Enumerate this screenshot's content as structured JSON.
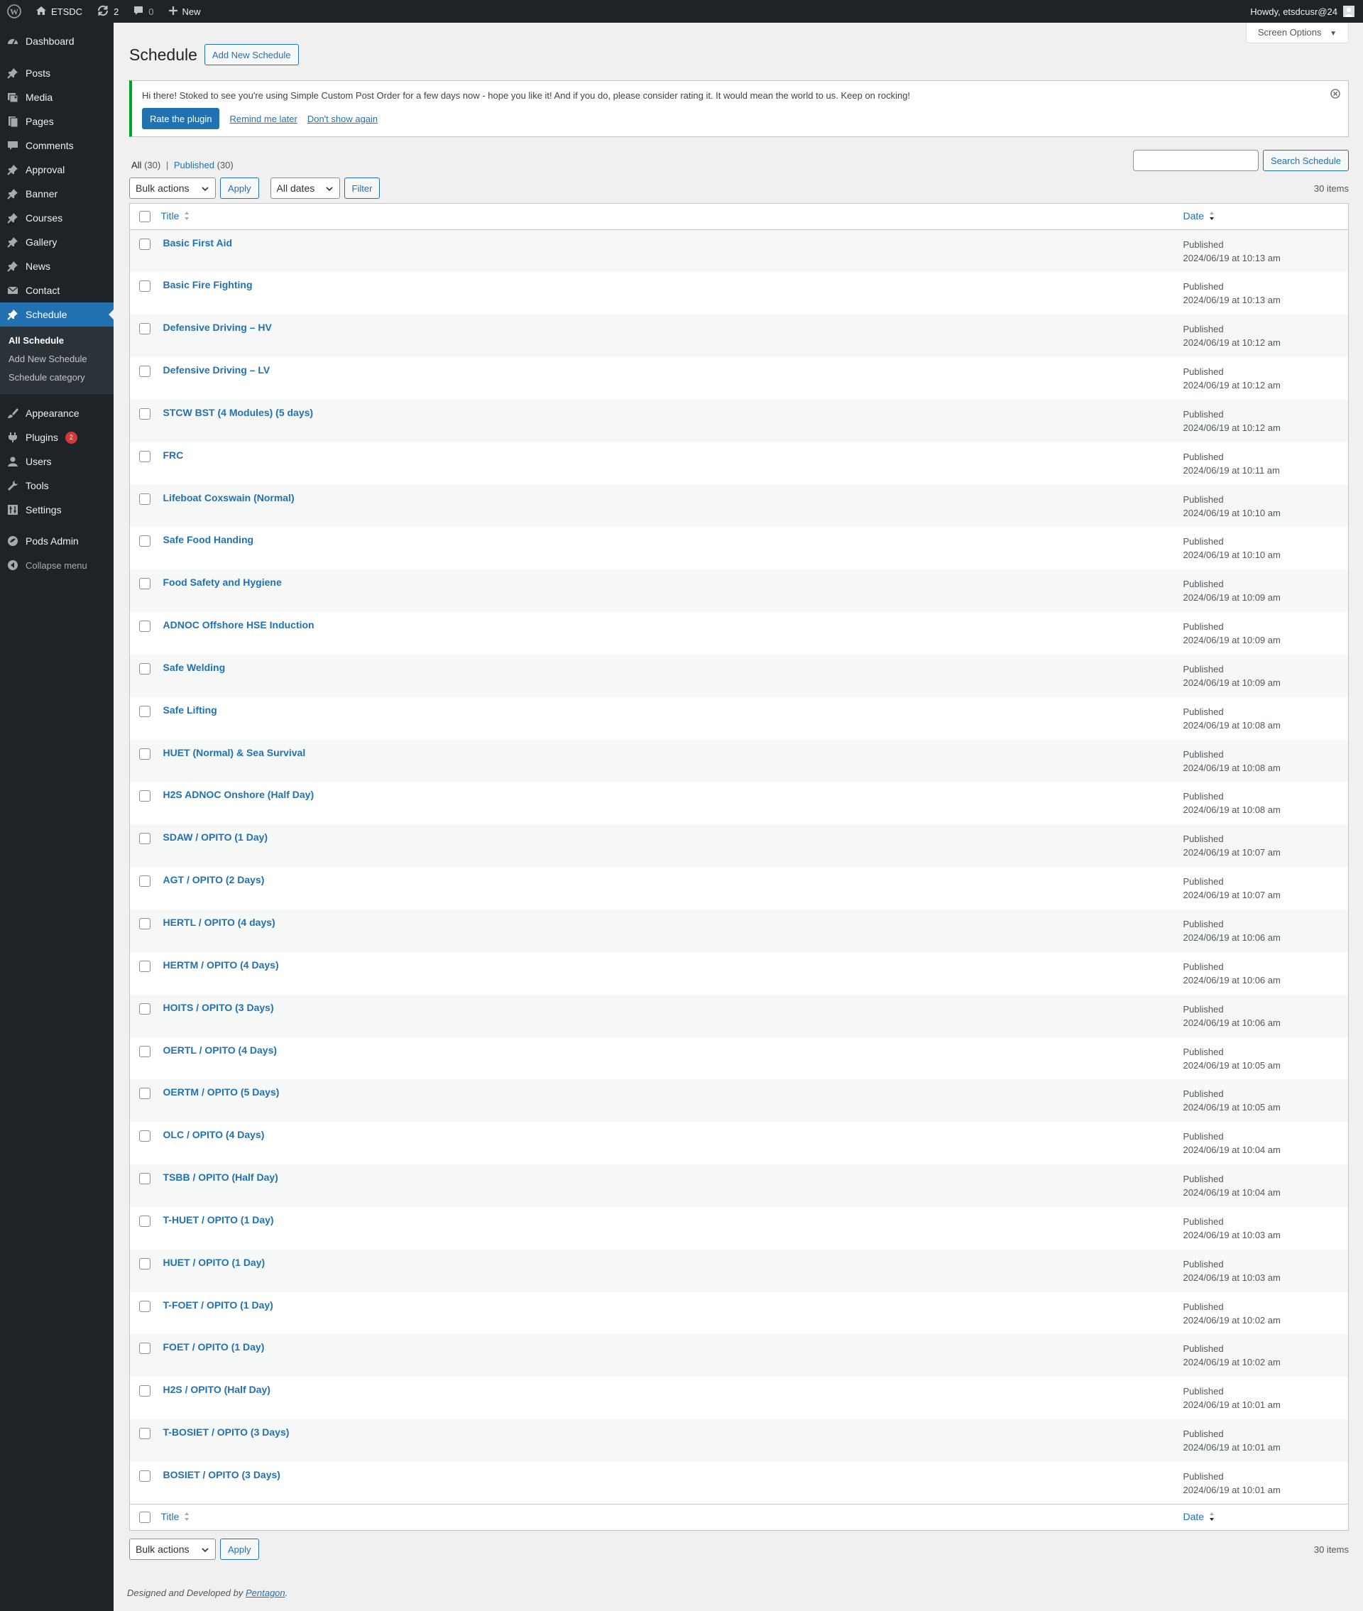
{
  "adminbar": {
    "site_name": "ETSDC",
    "updates_count": "2",
    "comments_count": "0",
    "new_label": "New",
    "howdy": "Howdy, etsdcusr@24"
  },
  "sidebar": {
    "items": [
      {
        "label": "Dashboard",
        "icon": "dashboard-icon"
      },
      {
        "label": "Posts",
        "icon": "pin-icon"
      },
      {
        "label": "Media",
        "icon": "media-icon"
      },
      {
        "label": "Pages",
        "icon": "pages-icon"
      },
      {
        "label": "Comments",
        "icon": "comments-icon"
      },
      {
        "label": "Approval",
        "icon": "pin-icon"
      },
      {
        "label": "Banner",
        "icon": "pin-icon"
      },
      {
        "label": "Courses",
        "icon": "pin-icon"
      },
      {
        "label": "Gallery",
        "icon": "pin-icon"
      },
      {
        "label": "News",
        "icon": "pin-icon"
      },
      {
        "label": "Contact",
        "icon": "mail-icon"
      },
      {
        "label": "Schedule",
        "icon": "pin-icon"
      },
      {
        "label": "Appearance",
        "icon": "brush-icon"
      },
      {
        "label": "Plugins",
        "icon": "plugin-icon",
        "badge": "2"
      },
      {
        "label": "Users",
        "icon": "users-icon"
      },
      {
        "label": "Tools",
        "icon": "wrench-icon"
      },
      {
        "label": "Settings",
        "icon": "settings-icon"
      },
      {
        "label": "Pods Admin",
        "icon": "pods-icon"
      },
      {
        "label": "Collapse menu",
        "icon": "collapse-icon"
      }
    ],
    "submenu": [
      "All Schedule",
      "Add New Schedule",
      "Schedule category"
    ]
  },
  "header": {
    "screen_options": "Screen Options",
    "title": "Schedule",
    "add_new": "Add New Schedule"
  },
  "notice": {
    "text": "Hi there! Stoked to see you're using Simple Custom Post Order for a few days now - hope you like it! And if you do, please consider rating it. It would mean the world to us. Keep on rocking!",
    "rate": "Rate the plugin",
    "remind": "Remind me later",
    "dont_show": "Don't show again"
  },
  "filters": {
    "all_label": "All",
    "all_count": "(30)",
    "sep": "|",
    "published_label": "Published",
    "published_count": "(30)",
    "search_button": "Search Schedule",
    "bulk_actions": "Bulk actions",
    "apply": "Apply",
    "all_dates": "All dates",
    "filter": "Filter",
    "items_count": "30 items"
  },
  "table": {
    "col_title": "Title",
    "col_date": "Date",
    "rows": [
      {
        "title": "Basic First Aid",
        "status": "Published",
        "date": "2024/06/19 at 10:13 am"
      },
      {
        "title": "Basic Fire Fighting",
        "status": "Published",
        "date": "2024/06/19 at 10:13 am"
      },
      {
        "title": "Defensive Driving – HV",
        "status": "Published",
        "date": "2024/06/19 at 10:12 am"
      },
      {
        "title": "Defensive Driving – LV",
        "status": "Published",
        "date": "2024/06/19 at 10:12 am"
      },
      {
        "title": "STCW BST (4 Modules) (5 days)",
        "status": "Published",
        "date": "2024/06/19 at 10:12 am"
      },
      {
        "title": "FRC",
        "status": "Published",
        "date": "2024/06/19 at 10:11 am"
      },
      {
        "title": "Lifeboat Coxswain (Normal)",
        "status": "Published",
        "date": "2024/06/19 at 10:10 am"
      },
      {
        "title": "Safe Food Handing",
        "status": "Published",
        "date": "2024/06/19 at 10:10 am"
      },
      {
        "title": "Food Safety and Hygiene",
        "status": "Published",
        "date": "2024/06/19 at 10:09 am"
      },
      {
        "title": "ADNOC Offshore HSE Induction",
        "status": "Published",
        "date": "2024/06/19 at 10:09 am"
      },
      {
        "title": "Safe Welding",
        "status": "Published",
        "date": "2024/06/19 at 10:09 am"
      },
      {
        "title": "Safe Lifting",
        "status": "Published",
        "date": "2024/06/19 at 10:08 am"
      },
      {
        "title": "HUET (Normal) & Sea Survival",
        "status": "Published",
        "date": "2024/06/19 at 10:08 am"
      },
      {
        "title": "H2S ADNOC Onshore (Half Day)",
        "status": "Published",
        "date": "2024/06/19 at 10:08 am"
      },
      {
        "title": "SDAW / OPITO (1 Day)",
        "status": "Published",
        "date": "2024/06/19 at 10:07 am"
      },
      {
        "title": "AGT / OPITO (2 Days)",
        "status": "Published",
        "date": "2024/06/19 at 10:07 am"
      },
      {
        "title": "HERTL / OPITO (4 days)",
        "status": "Published",
        "date": "2024/06/19 at 10:06 am"
      },
      {
        "title": "HERTM / OPITO (4 Days)",
        "status": "Published",
        "date": "2024/06/19 at 10:06 am"
      },
      {
        "title": "HOITS / OPITO (3 Days)",
        "status": "Published",
        "date": "2024/06/19 at 10:06 am"
      },
      {
        "title": "OERTL / OPITO (4 Days)",
        "status": "Published",
        "date": "2024/06/19 at 10:05 am"
      },
      {
        "title": "OERTM / OPITO (5 Days)",
        "status": "Published",
        "date": "2024/06/19 at 10:05 am"
      },
      {
        "title": "OLC / OPITO (4 Days)",
        "status": "Published",
        "date": "2024/06/19 at 10:04 am"
      },
      {
        "title": "TSBB / OPITO (Half Day)",
        "status": "Published",
        "date": "2024/06/19 at 10:04 am"
      },
      {
        "title": "T-HUET / OPITO (1 Day)",
        "status": "Published",
        "date": "2024/06/19 at 10:03 am"
      },
      {
        "title": "HUET / OPITO (1 Day)",
        "status": "Published",
        "date": "2024/06/19 at 10:03 am"
      },
      {
        "title": "T-FOET / OPITO (1 Day)",
        "status": "Published",
        "date": "2024/06/19 at 10:02 am"
      },
      {
        "title": "FOET / OPITO (1 Day)",
        "status": "Published",
        "date": "2024/06/19 at 10:02 am"
      },
      {
        "title": "H2S / OPITO (Half Day)",
        "status": "Published",
        "date": "2024/06/19 at 10:01 am"
      },
      {
        "title": "T-BOSIET / OPITO (3 Days)",
        "status": "Published",
        "date": "2024/06/19 at 10:01 am"
      },
      {
        "title": "BOSIET / OPITO (3 Days)",
        "status": "Published",
        "date": "2024/06/19 at 10:01 am"
      }
    ]
  },
  "footer": {
    "prefix": "Designed and Developed by",
    "link": "Pentagon",
    "suffix": "."
  }
}
